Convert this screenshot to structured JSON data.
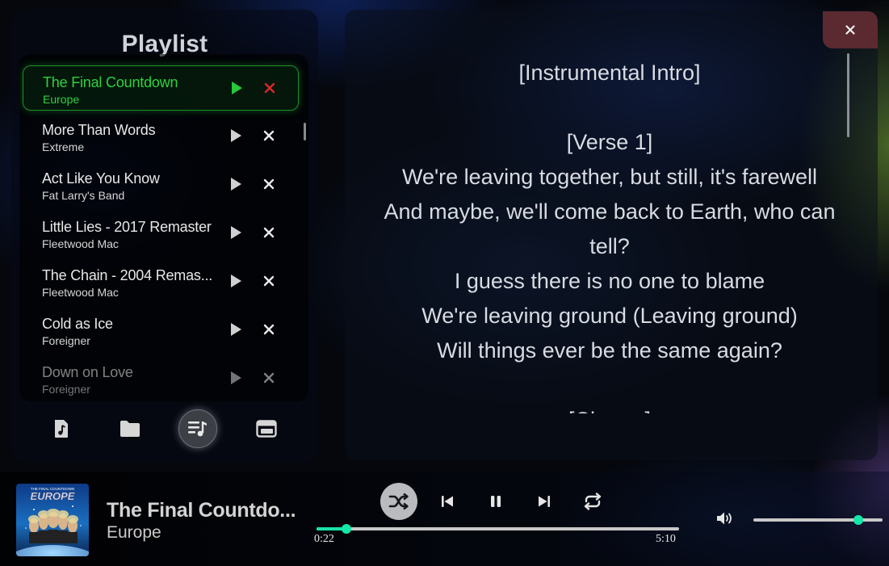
{
  "playlist": {
    "title": "Playlist",
    "tracks": [
      {
        "title": "The Final Countdown",
        "artist": "Europe",
        "active": true
      },
      {
        "title": "More Than Words",
        "artist": "Extreme"
      },
      {
        "title": "Act Like You Know",
        "artist": "Fat Larry's Band"
      },
      {
        "title": "Little Lies - 2017 Remaster",
        "artist": "Fleetwood Mac"
      },
      {
        "title": "The Chain - 2004 Remas...",
        "artist": "Fleetwood Mac"
      },
      {
        "title": "Cold as Ice",
        "artist": "Foreigner"
      },
      {
        "title": "Down on Love",
        "artist": "Foreigner"
      }
    ],
    "nav": [
      {
        "icon": "music-file-icon"
      },
      {
        "icon": "folder-icon"
      },
      {
        "icon": "queue-music-icon",
        "active": true
      },
      {
        "icon": "window-icon"
      }
    ]
  },
  "lyrics": {
    "lines": [
      "[Instrumental Intro]",
      "",
      "[Verse 1]",
      "We're leaving together, but still, it's farewell",
      "And maybe, we'll come back to Earth, who can",
      "tell?",
      "I guess there is no one to blame",
      "We're leaving ground (Leaving ground)",
      "Will things ever be the same again?",
      "",
      "[Chorus]"
    ]
  },
  "player": {
    "title": "The Final Countdo...",
    "artist": "Europe",
    "album_art_text": "EUROPE",
    "album_art_subtitle": "THE FINAL COUNTDOWN",
    "current_time": "0:22",
    "total_time": "5:10",
    "progress": 0.083,
    "volume": 0.81,
    "shuffle_on": true,
    "accent_color": "#14e8a9"
  }
}
